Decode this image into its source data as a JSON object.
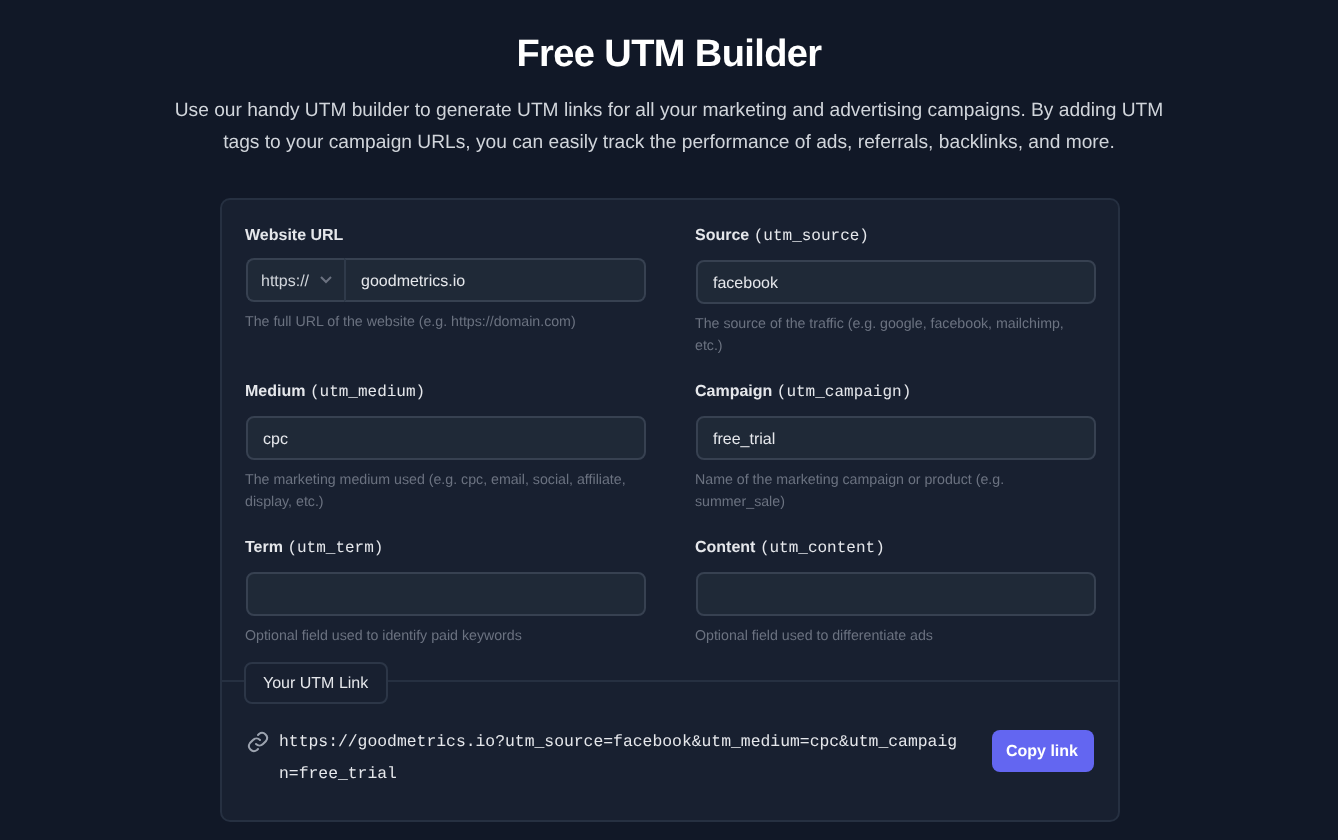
{
  "title": "Free UTM Builder",
  "description": "Use our handy UTM builder to generate UTM links for all your marketing and advertising campaigns. By adding UTM tags to your campaign URLs, you can easily track the performance of ads, referrals, backlinks, and more.",
  "fields": [
    {
      "label": "Website URL",
      "protocol": "https://",
      "value": "goodmetrics.io",
      "hint": "The full URL of the website (e.g. https://domain.com)"
    },
    {
      "label": "Source",
      "param": "(utm_source)",
      "value": "facebook",
      "hint": "The source of the traffic (e.g. google, facebook, mailchimp, etc.)"
    },
    {
      "label": "Medium",
      "param": "(utm_medium)",
      "value": "cpc",
      "hint": "The marketing medium used (e.g. cpc, email, social, affiliate, display, etc.)"
    },
    {
      "label": "Campaign",
      "param": "(utm_campaign)",
      "value": "free_trial",
      "hint": "Name of the marketing campaign or product (e.g. summer_sale)"
    },
    {
      "label": "Term",
      "param": "(utm_term)",
      "hint": "Optional field used to identify paid keywords"
    },
    {
      "label": "Content",
      "param": "(utm_content)",
      "hint": "Optional field used to differentiate ads"
    }
  ],
  "result": {
    "tab": "Your UTM Link",
    "link": "https://goodmetrics.io?utm_source=facebook&utm_medium=cpc&utm_campaign=free_trial",
    "button": "Copy link"
  }
}
